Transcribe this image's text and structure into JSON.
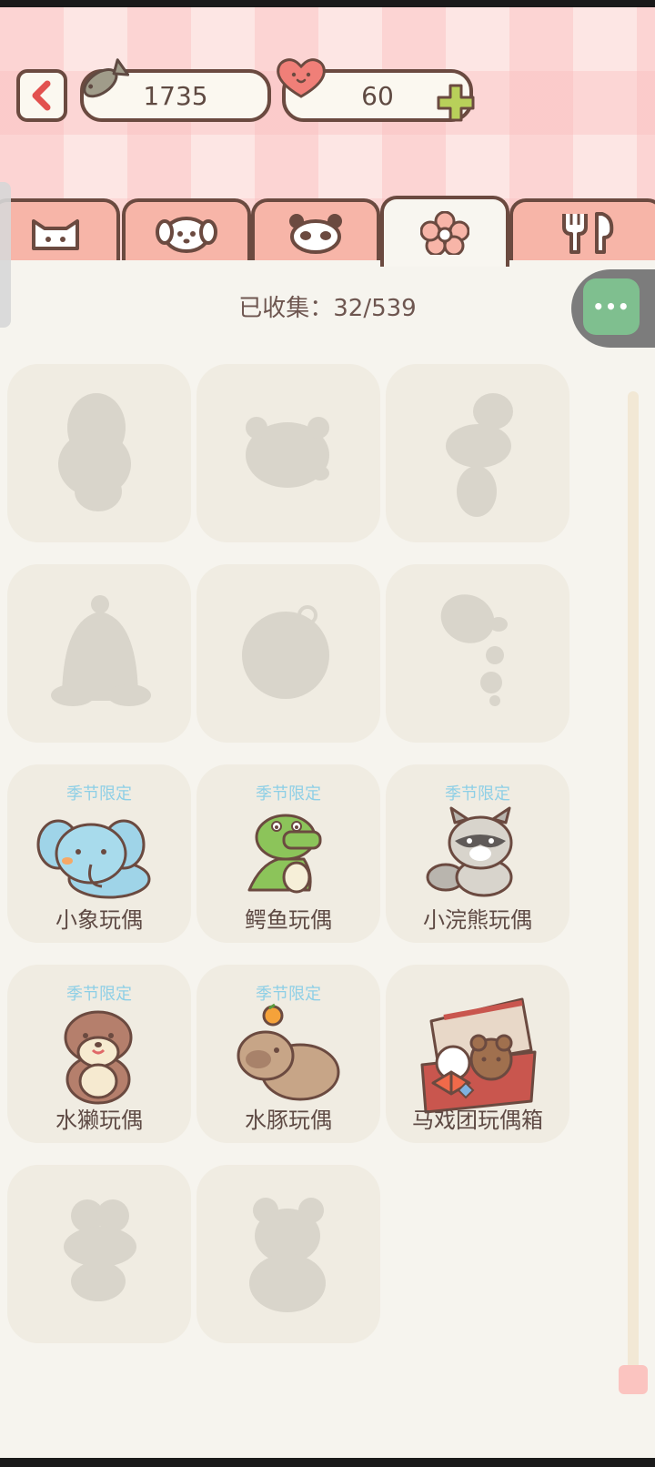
{
  "header": {
    "fish_count": "1735",
    "heart_count": "60"
  },
  "tabs": [
    {
      "icon": "cat-face-icon",
      "active": false
    },
    {
      "icon": "dog-face-icon",
      "active": false
    },
    {
      "icon": "panda-face-icon",
      "active": false
    },
    {
      "icon": "flower-icon",
      "active": true
    },
    {
      "icon": "fork-spoon-icon",
      "active": false
    }
  ],
  "collection": {
    "collected_text": "已收集：32/539"
  },
  "items": [
    {
      "locked": true,
      "tag": "",
      "name": ""
    },
    {
      "locked": true,
      "tag": "",
      "name": ""
    },
    {
      "locked": true,
      "tag": "",
      "name": ""
    },
    {
      "locked": true,
      "tag": "",
      "name": ""
    },
    {
      "locked": true,
      "tag": "",
      "name": ""
    },
    {
      "locked": true,
      "tag": "",
      "name": ""
    },
    {
      "locked": false,
      "tag": "季节限定",
      "name": "小象玩偶",
      "icon": "elephant-plush-icon"
    },
    {
      "locked": false,
      "tag": "季节限定",
      "name": "鳄鱼玩偶",
      "icon": "crocodile-plush-icon"
    },
    {
      "locked": false,
      "tag": "季节限定",
      "name": "小浣熊玩偶",
      "icon": "raccoon-plush-icon"
    },
    {
      "locked": false,
      "tag": "季节限定",
      "name": "水獭玩偶",
      "icon": "otter-plush-icon"
    },
    {
      "locked": false,
      "tag": "季节限定",
      "name": "水豚玩偶",
      "icon": "capybara-plush-icon"
    },
    {
      "locked": false,
      "tag": "",
      "name": "马戏团玩偶箱",
      "icon": "circus-toy-box-icon"
    },
    {
      "locked": true,
      "tag": "",
      "name": ""
    },
    {
      "locked": true,
      "tag": "",
      "name": ""
    }
  ],
  "colors": {
    "accent_pink": "#f7b5a8",
    "outline_brown": "#6b4a40",
    "more_green": "#7fbf8f",
    "tag_blue": "#8ecfe6"
  }
}
